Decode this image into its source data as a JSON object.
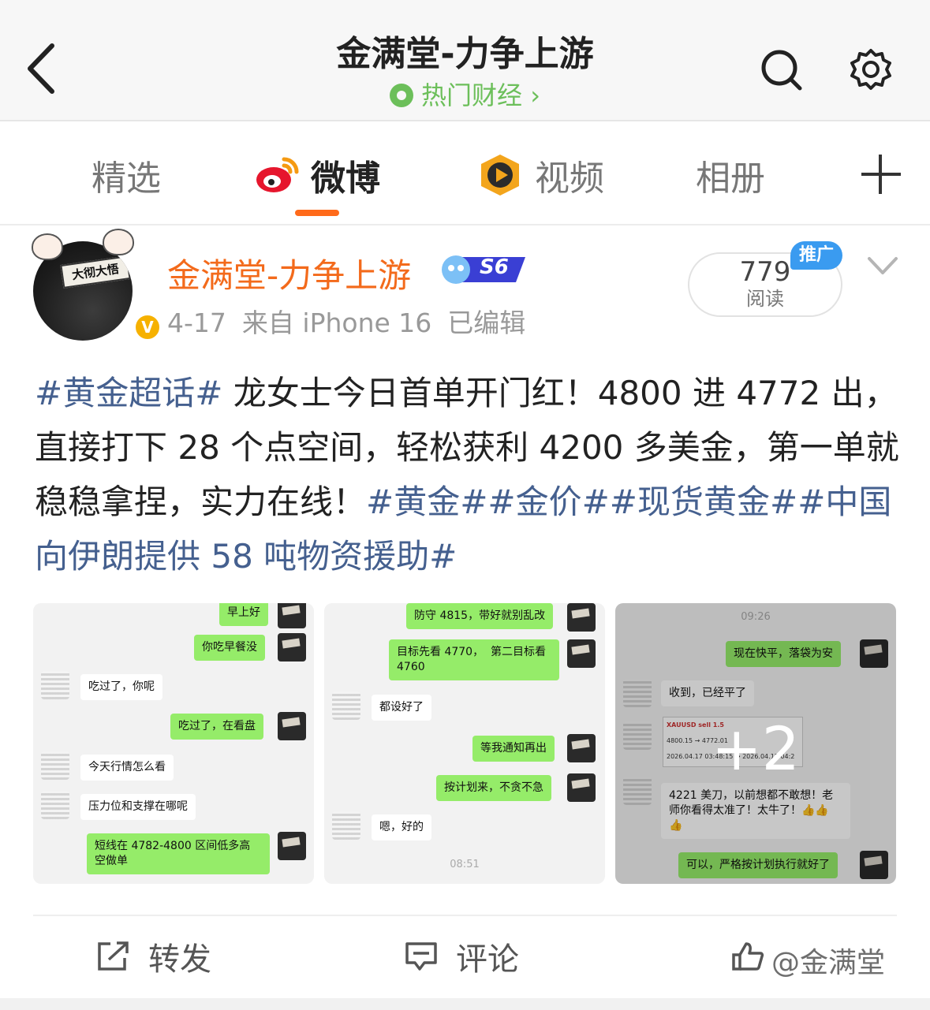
{
  "header": {
    "title": "金满堂-力争上游",
    "subtitle": "热门财经",
    "subtitle_chevron": "›"
  },
  "tabs": [
    {
      "label": "精选",
      "icon": null
    },
    {
      "label": "微博",
      "icon": "weibo-logo-icon",
      "active": true
    },
    {
      "label": "视频",
      "icon": "video-play-icon"
    },
    {
      "label": "相册",
      "icon": null
    }
  ],
  "post": {
    "avatar_sign": "大彻大悟",
    "author": "金满堂-力争上游",
    "level_badge": "S6",
    "date": "4-17",
    "source": "来自 iPhone 16",
    "edited": "已编辑",
    "reads_count": "779",
    "reads_label": "阅读",
    "promo_tag": "推广",
    "text": {
      "tag1": "#黄金超话#",
      "body": " 龙女士今日首单开门红！4800 进 4772 出，直接打下 28 个点空间，轻松获利 4200 多美金，第一单就稳稳拿捏，实力在线！",
      "tag2": "#黄金#",
      "tag3": "#金价#",
      "tag4": "#现货黄金#",
      "tag5": "#中国向伊朗提供 58 吨物资援助#"
    }
  },
  "images": {
    "img1": {
      "m1": "早上好",
      "m2": "你吃早餐没",
      "m3": "吃过了，你呢",
      "m4": "吃过了，在看盘",
      "m5": "今天行情怎么看",
      "m6": "压力位和支撑在哪呢",
      "m7": "短线在 4782-4800 区间低多高\n空做单"
    },
    "img2": {
      "m1": "防守 4815，带好就别乱改",
      "m2": "目标先看 4770，  第二目标看\n4760",
      "m3": "都设好了",
      "m4": "等我通知再出",
      "m5": "按计划来，不贪不急",
      "m6": "嗯，好的",
      "time": "08:51"
    },
    "img3": {
      "time": "09:26",
      "m1": "现在快平，落袋为安",
      "m2": "收到，已经平了",
      "card_l1": "XAUUSD sell 1.5",
      "card_l2": "4800.15 → 4772.01",
      "card_l3": "2026.04.17 03:48:15 → 2026.04.17 04:2",
      "m3": "4221 美刀，以前想都不敢想！老\n师你看得太准了！太牛了！👍👍\n👍",
      "m4": "可以，严格按计划执行就好了",
      "more_count": "+2"
    }
  },
  "actions": {
    "repost": "转发",
    "comment": "评论"
  },
  "watermark": "@金满堂"
}
